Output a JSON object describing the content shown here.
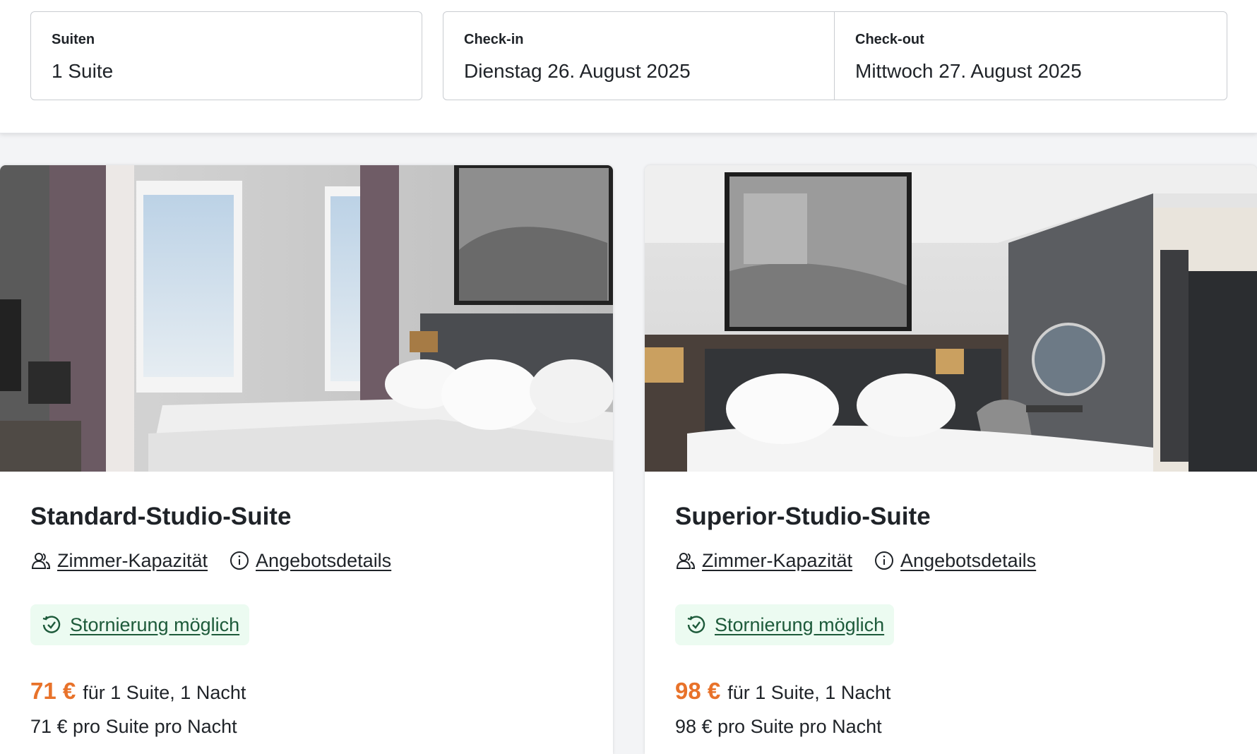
{
  "search": {
    "suites": {
      "label": "Suiten",
      "value": "1 Suite"
    },
    "checkin": {
      "label": "Check-in",
      "value": "Dienstag 26. August 2025"
    },
    "checkout": {
      "label": "Check-out",
      "value": "Mittwoch 27. August 2025"
    }
  },
  "rooms": [
    {
      "title": "Standard-Studio-Suite",
      "capacity_link": "Zimmer-Kapazität",
      "offer_link": "Angebotsdetails",
      "cancellation": "Stornierung möglich",
      "price": "71 €",
      "price_suffix": "für 1 Suite, 1 Nacht",
      "per_night": "71 € pro Suite pro Nacht",
      "image_icon": "hotel-room-photo"
    },
    {
      "title": "Superior-Studio-Suite",
      "capacity_link": "Zimmer-Kapazität",
      "offer_link": "Angebotsdetails",
      "cancellation": "Stornierung möglich",
      "price": "98 €",
      "price_suffix": "für 1 Suite, 1 Nacht",
      "per_night": "98 € pro Suite pro Nacht",
      "image_icon": "hotel-room-photo"
    }
  ],
  "colors": {
    "price": "#e8722a",
    "badge_bg": "#ecfbf1",
    "badge_text": "#1d5a3a",
    "page_bg": "#f3f4f6"
  },
  "icons": {
    "capacity": "users-icon",
    "offer": "info-icon",
    "cancellation": "refresh-check-icon"
  }
}
